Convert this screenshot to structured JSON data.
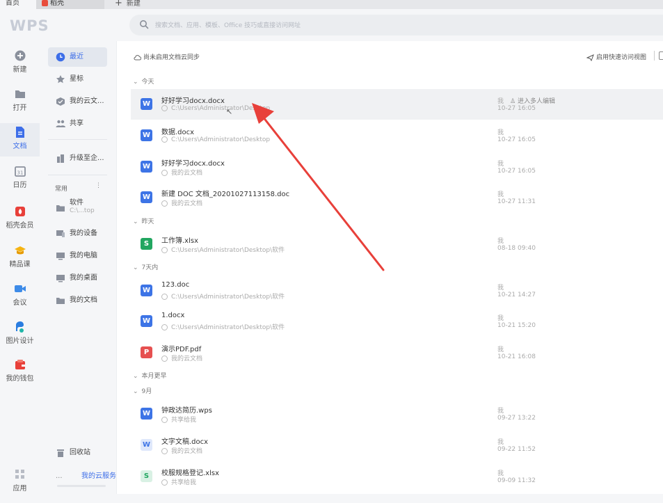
{
  "tabs": [
    {
      "label": "首页"
    },
    {
      "label": "稻壳"
    },
    {
      "label": "新建"
    }
  ],
  "header": {
    "logo": "WPS",
    "search_placeholder": "搜索文档、应用、模板、Office 技巧或直接访问网址"
  },
  "rail": [
    {
      "label": "新建",
      "icon": "plus-circle-icon"
    },
    {
      "label": "打开",
      "icon": "folder-icon"
    },
    {
      "label": "文档",
      "icon": "document-icon",
      "active": true
    },
    {
      "label": "日历",
      "icon": "calendar-icon"
    },
    {
      "label": "稻壳会员",
      "icon": "daoke-icon"
    },
    {
      "label": "精品课",
      "icon": "graduation-cap-icon"
    },
    {
      "label": "会议",
      "icon": "video-icon"
    },
    {
      "label": "图片设计",
      "icon": "image-design-icon"
    },
    {
      "label": "我的钱包",
      "icon": "wallet-icon"
    },
    {
      "label": "应用",
      "icon": "apps-grid-icon"
    }
  ],
  "sidebar": {
    "recent": "最近",
    "starred": "星标",
    "my_cloud": "我的云文...",
    "shared": "共享",
    "upgrade": "升级至企...",
    "common_head": "常用",
    "software": "软件",
    "software_path": "C:\\...top",
    "my_device": "我的设备",
    "my_computer": "我的电脑",
    "my_desktop": "我的桌面",
    "my_documents": "我的文档",
    "recycle": "回收站",
    "cloud_service": "我的云服务",
    "more": "..."
  },
  "main": {
    "cloud_sync": "尚未启用文档云同步",
    "quick_view": "启用快速访问视图",
    "groups": {
      "today": "今天",
      "yesterday": "昨天",
      "week": "7天内",
      "month": "本月更早",
      "sep": "9月"
    },
    "files": [
      {
        "name": "好好学习docx.docx",
        "path": "C:\\Users\\Administrator\\Desktop",
        "owner": "我",
        "collab": "进入多人编辑",
        "time": "10-27 16:05",
        "type": "W"
      },
      {
        "name": "数据.docx",
        "path": "C:\\Users\\Administrator\\Desktop",
        "owner": "我",
        "time": "10-27 16:05",
        "type": "W"
      },
      {
        "name": "好好学习docx.docx",
        "path": "我的云文档",
        "owner": "我",
        "time": "10-27 16:05",
        "type": "W"
      },
      {
        "name": "新建 DOC 文档_20201027113158.doc",
        "path": "我的云文档",
        "owner": "我",
        "time": "10-27 11:31",
        "type": "W"
      },
      {
        "name": "工作簿.xlsx",
        "path": "C:\\Users\\Administrator\\Desktop\\软件",
        "owner": "我",
        "time": "08-18 09:40",
        "type": "S"
      },
      {
        "name": "123.doc",
        "path": "C:\\Users\\Administrator\\Desktop\\软件",
        "owner": "我",
        "time": "10-21 14:27",
        "type": "W"
      },
      {
        "name": "1.docx",
        "path": "C:\\Users\\Administrator\\Desktop\\软件",
        "owner": "我",
        "time": "10-21 15:20",
        "type": "W"
      },
      {
        "name": "演示PDF.pdf",
        "path": "我的云文档",
        "owner": "我",
        "time": "10-21 16:08",
        "type": "P"
      },
      {
        "name": "钟政达简历.wps",
        "path": "共享给我",
        "owner": "我",
        "time": "09-27 13:22",
        "type": "W"
      },
      {
        "name": "文字文稿.docx",
        "path": "我的云文档",
        "owner": "我",
        "time": "09-22 11:52",
        "type": "W"
      },
      {
        "name": "校服规格登记.xlsx",
        "path": "共享给我",
        "owner": "我",
        "time": "09-09 11:32",
        "type": "S"
      }
    ]
  },
  "colors": {
    "accent": "#3d6ee8",
    "word": "#3d74e6",
    "sheet": "#22a660",
    "pdf": "#e65050",
    "arrow": "#e8403a"
  }
}
